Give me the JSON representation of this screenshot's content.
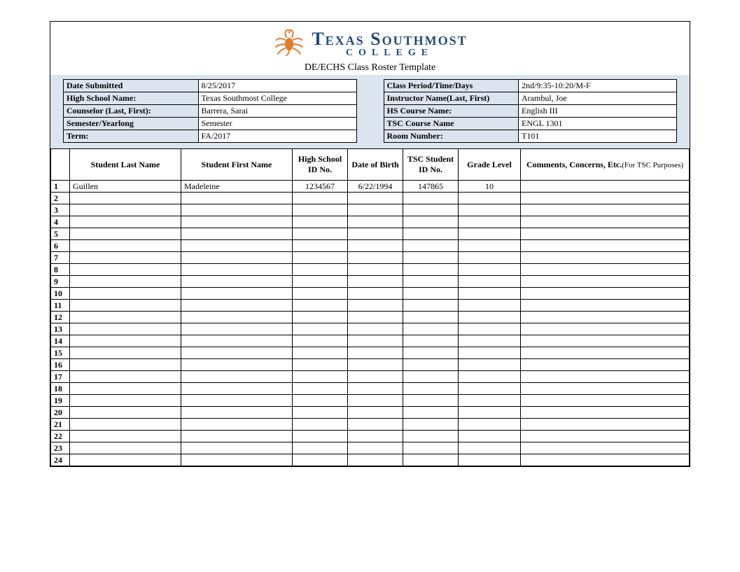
{
  "header": {
    "org_name_top": "Texas Southmost",
    "org_name_sub": "COLLEGE",
    "subtitle": "DE/ECHS Class Roster Template"
  },
  "left_fields": [
    {
      "label": "Date Submitted",
      "value": "8/25/2017"
    },
    {
      "label": "High School Name:",
      "value": "Texas Southmost College"
    },
    {
      "label": "Counselor (Last, First):",
      "value": "Barrera, Sarai"
    },
    {
      "label": "Semester/Yearlong",
      "value": "Semester"
    },
    {
      "label": "Term:",
      "value": "FA/2017"
    }
  ],
  "right_fields": [
    {
      "label": "Class Period/Time/Days",
      "value": "2nd/9:35-10:20/M-F"
    },
    {
      "label": "Instructor Name(Last, First)",
      "value": "Arambul, Joe"
    },
    {
      "label": "HS Course Name:",
      "value": "English III"
    },
    {
      "label": "TSC Course Name",
      "value": "ENGL 1301"
    },
    {
      "label": "Room Number:",
      "value": "T101"
    }
  ],
  "columns": {
    "last": "Student Last Name",
    "first": "Student First Name",
    "hsid": "High School ID No.",
    "dob": "Date of Birth",
    "tscid": "TSC Student ID No.",
    "grade": "Grade Level",
    "comments_main": "Comments, Concerns, Etc.",
    "comments_sub": "(For TSC Purposes)"
  },
  "rows": [
    {
      "n": "1",
      "last": "Guillen",
      "first": "Madeleine",
      "hsid": "1234567",
      "dob": "6/22/1994",
      "tscid": "147865",
      "grade": "10",
      "comments": ""
    },
    {
      "n": "2",
      "last": "",
      "first": "",
      "hsid": "",
      "dob": "",
      "tscid": "",
      "grade": "",
      "comments": ""
    },
    {
      "n": "3",
      "last": "",
      "first": "",
      "hsid": "",
      "dob": "",
      "tscid": "",
      "grade": "",
      "comments": ""
    },
    {
      "n": "4",
      "last": "",
      "first": "",
      "hsid": "",
      "dob": "",
      "tscid": "",
      "grade": "",
      "comments": ""
    },
    {
      "n": "5",
      "last": "",
      "first": "",
      "hsid": "",
      "dob": "",
      "tscid": "",
      "grade": "",
      "comments": ""
    },
    {
      "n": "6",
      "last": "",
      "first": "",
      "hsid": "",
      "dob": "",
      "tscid": "",
      "grade": "",
      "comments": ""
    },
    {
      "n": "7",
      "last": "",
      "first": "",
      "hsid": "",
      "dob": "",
      "tscid": "",
      "grade": "",
      "comments": ""
    },
    {
      "n": "8",
      "last": "",
      "first": "",
      "hsid": "",
      "dob": "",
      "tscid": "",
      "grade": "",
      "comments": ""
    },
    {
      "n": "9",
      "last": "",
      "first": "",
      "hsid": "",
      "dob": "",
      "tscid": "",
      "grade": "",
      "comments": ""
    },
    {
      "n": "10",
      "last": "",
      "first": "",
      "hsid": "",
      "dob": "",
      "tscid": "",
      "grade": "",
      "comments": ""
    },
    {
      "n": "11",
      "last": "",
      "first": "",
      "hsid": "",
      "dob": "",
      "tscid": "",
      "grade": "",
      "comments": ""
    },
    {
      "n": "12",
      "last": "",
      "first": "",
      "hsid": "",
      "dob": "",
      "tscid": "",
      "grade": "",
      "comments": ""
    },
    {
      "n": "13",
      "last": "",
      "first": "",
      "hsid": "",
      "dob": "",
      "tscid": "",
      "grade": "",
      "comments": ""
    },
    {
      "n": "14",
      "last": "",
      "first": "",
      "hsid": "",
      "dob": "",
      "tscid": "",
      "grade": "",
      "comments": ""
    },
    {
      "n": "15",
      "last": "",
      "first": "",
      "hsid": "",
      "dob": "",
      "tscid": "",
      "grade": "",
      "comments": ""
    },
    {
      "n": "16",
      "last": "",
      "first": "",
      "hsid": "",
      "dob": "",
      "tscid": "",
      "grade": "",
      "comments": ""
    },
    {
      "n": "17",
      "last": "",
      "first": "",
      "hsid": "",
      "dob": "",
      "tscid": "",
      "grade": "",
      "comments": ""
    },
    {
      "n": "18",
      "last": "",
      "first": "",
      "hsid": "",
      "dob": "",
      "tscid": "",
      "grade": "",
      "comments": ""
    },
    {
      "n": "19",
      "last": "",
      "first": "",
      "hsid": "",
      "dob": "",
      "tscid": "",
      "grade": "",
      "comments": ""
    },
    {
      "n": "20",
      "last": "",
      "first": "",
      "hsid": "",
      "dob": "",
      "tscid": "",
      "grade": "",
      "comments": ""
    },
    {
      "n": "21",
      "last": "",
      "first": "",
      "hsid": "",
      "dob": "",
      "tscid": "",
      "grade": "",
      "comments": ""
    },
    {
      "n": "22",
      "last": "",
      "first": "",
      "hsid": "",
      "dob": "",
      "tscid": "",
      "grade": "",
      "comments": ""
    },
    {
      "n": "23",
      "last": "",
      "first": "",
      "hsid": "",
      "dob": "",
      "tscid": "",
      "grade": "",
      "comments": ""
    },
    {
      "n": "24",
      "last": "",
      "first": "",
      "hsid": "",
      "dob": "",
      "tscid": "",
      "grade": "",
      "comments": ""
    }
  ]
}
